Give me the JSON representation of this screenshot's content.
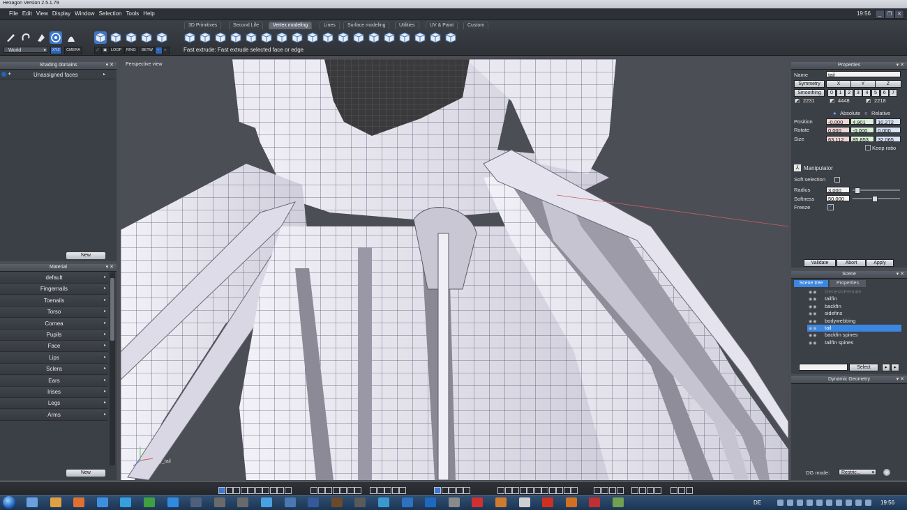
{
  "app": {
    "title": "Hexagon Version 2.5.1.79",
    "clock": "19:56"
  },
  "menu": [
    "File",
    "Edit",
    "View",
    "Display",
    "Window",
    "Selection",
    "Tools",
    "Help"
  ],
  "tabs": [
    {
      "label": "3D Primitives",
      "active": false
    },
    {
      "label": "Second Life",
      "active": false
    },
    {
      "label": "Vertex modeling",
      "active": true
    },
    {
      "label": "Lines",
      "active": false
    },
    {
      "label": "Surface modeling",
      "active": false
    },
    {
      "label": "Utilities",
      "active": false
    },
    {
      "label": "UV & Paint",
      "active": false
    },
    {
      "label": "Custom",
      "active": false
    }
  ],
  "toolbar": {
    "coord_space": "World",
    "xyz_label": "XYZ",
    "camera_label": "CMERA",
    "loop_label": "LOOP",
    "ring_label": "RING",
    "betw_label": "BETW",
    "hint": "Fast extrude: Fast extrude selected face or edge"
  },
  "shading_domains": {
    "title": "Shading domains",
    "item": "Unassigned faces",
    "new_label": "New"
  },
  "material": {
    "title": "Material",
    "items": [
      "default",
      "Fingernails",
      "Toenails",
      "Torso",
      "Cornea",
      "Pupils",
      "Face",
      "Lips",
      "Sclera",
      "Ears",
      "Irises",
      "Legs",
      "Arms"
    ],
    "new_label": "New"
  },
  "viewport": {
    "label": "Perspective view",
    "axis_label": "xy_tail"
  },
  "properties": {
    "title": "Properties",
    "name_label": "Name",
    "name_value": "tail",
    "symmetry_label": "Symmetry",
    "sym_axes": [
      "X",
      "Y",
      "Z"
    ],
    "smoothing_label": "Smoothing",
    "smoothing_levels": [
      "0",
      "1",
      "2",
      "3",
      "4",
      "5",
      "6",
      "7"
    ],
    "counts": [
      "2231",
      "4448",
      "2218"
    ],
    "absolute_label": "Absolute",
    "relative_label": "Relative",
    "position_label": "Position",
    "position": [
      "-0.000",
      "4.901",
      "10.272"
    ],
    "rotate_label": "Rotate",
    "rotate": [
      "0.000",
      "-0.000",
      "0.000"
    ],
    "size_label": "Size",
    "size": [
      "63.112",
      "85.853",
      "32.065"
    ],
    "keep_ratio_label": "Keep ratio",
    "manipulator_label": "Manipulator",
    "soft_selection_label": "Soft selection",
    "radius_label": "Radius",
    "radius_value": "3.000",
    "softness_label": "Softness",
    "softness_value": "50.000",
    "freeze_label": "Freeze",
    "validate_label": "Validate",
    "abort_label": "Abort",
    "apply_label": "Apply"
  },
  "scene": {
    "title": "Scene",
    "tab_tree": "Scene tree",
    "tab_properties": "Properties",
    "items": [
      "GenesisFemale",
      "tailfin",
      "backfin",
      "sidefins",
      "bodywebbing",
      "tail",
      "backfin spines",
      "tailfin spines"
    ],
    "selected_index": 5,
    "select_label": "Select"
  },
  "dynamic_geometry": {
    "title": "Dynamic Geometry",
    "dg_mode_label": "DG mode:",
    "dg_mode_value": "Restric..."
  },
  "taskbar": {
    "language": "DE",
    "clock": "19:56"
  },
  "colors": {
    "accent": "#3b86e0",
    "viewport_bg": "#4b4e54",
    "mesh_face": "#e7e5ef",
    "mesh_dark": "#3a3a3c"
  }
}
